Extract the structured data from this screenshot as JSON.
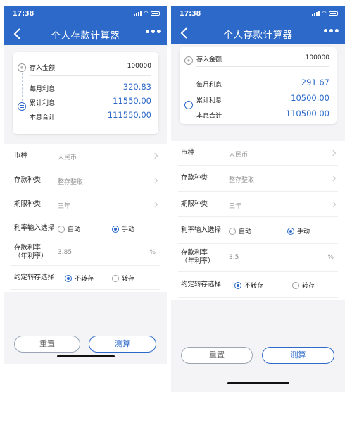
{
  "colors": {
    "brand": "#2c69c9",
    "background": "#f4f4f6",
    "muted": "#999999"
  },
  "screens": [
    {
      "status": {
        "time": "17:38"
      },
      "nav": {
        "title": "个人存款计算器",
        "back_icon": "chevron-left-icon",
        "more_icon": "more-icon"
      },
      "summary": {
        "deposit_label": "存入金额",
        "deposit_value": "100000",
        "monthly_label": "每月利息",
        "monthly_value": "320.83",
        "cumulative_label": "累计利息",
        "cumulative_value": "11550.00",
        "total_label": "本息合计",
        "total_value": "111550.00"
      },
      "form": {
        "currency_label": "币种",
        "currency_value": "人民币",
        "deposit_type_label": "存款种类",
        "deposit_type_value": "整存整取",
        "term_label": "期限种类",
        "term_value": "三年",
        "rate_mode_label": "利率输入选择",
        "rate_mode_auto": "自动",
        "rate_mode_manual": "手动",
        "rate_mode_selected": "manual",
        "rate_label_line1": "存款利率",
        "rate_label_line2": "（年利率）",
        "rate_value": "3.85",
        "rate_unit": "%",
        "rollover_label": "约定转存选择",
        "rollover_no": "不转存",
        "rollover_yes": "转存",
        "rollover_selected": "no"
      },
      "buttons": {
        "reset_label": "重置",
        "calculate_label": "测算"
      }
    },
    {
      "status": {
        "time": "17:38"
      },
      "nav": {
        "title": "个人存款计算器",
        "back_icon": "chevron-left-icon",
        "more_icon": "more-icon"
      },
      "summary": {
        "deposit_label": "存入金额",
        "deposit_value": "100000",
        "monthly_label": "每月利息",
        "monthly_value": "291.67",
        "cumulative_label": "累计利息",
        "cumulative_value": "10500.00",
        "total_label": "本息合计",
        "total_value": "110500.00"
      },
      "form": {
        "currency_label": "币种",
        "currency_value": "人民币",
        "deposit_type_label": "存款种类",
        "deposit_type_value": "整存整取",
        "term_label": "期限种类",
        "term_value": "三年",
        "rate_mode_label": "利率输入选择",
        "rate_mode_auto": "自动",
        "rate_mode_manual": "手动",
        "rate_mode_selected": "manual",
        "rate_label_line1": "存款利率",
        "rate_label_line2": "（年利率）",
        "rate_value": "3.5",
        "rate_unit": "%",
        "rollover_label": "约定转存选择",
        "rollover_no": "不转存",
        "rollover_yes": "转存",
        "rollover_selected": "no"
      },
      "buttons": {
        "reset_label": "重置",
        "calculate_label": "测算"
      }
    }
  ]
}
